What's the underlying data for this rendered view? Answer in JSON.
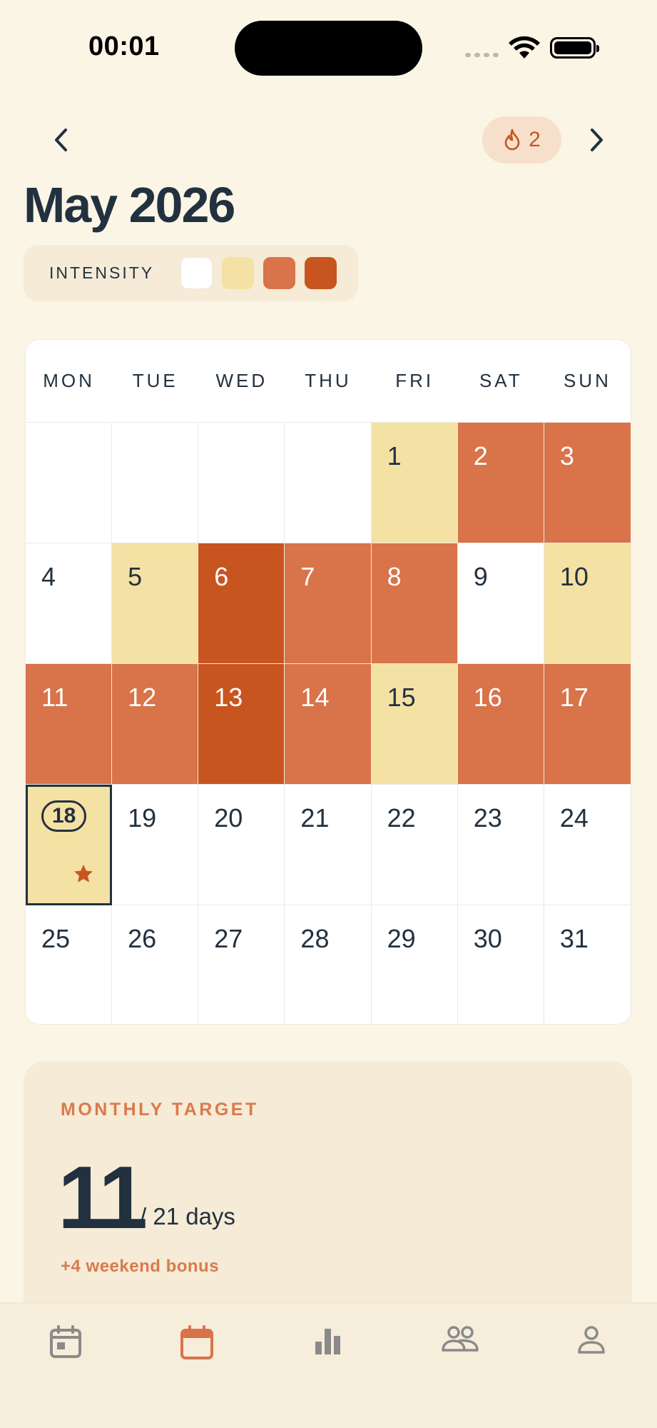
{
  "status_bar": {
    "time": "00:01"
  },
  "header": {
    "streak_count": "2",
    "title": "May 2026"
  },
  "legend": {
    "label": "INTENSITY",
    "colors": [
      "#FFFFFF",
      "#F4E1A4",
      "#D8734A",
      "#C8551F"
    ]
  },
  "calendar": {
    "weekdays": [
      "MON",
      "TUE",
      "WED",
      "THU",
      "FRI",
      "SAT",
      "SUN"
    ],
    "leading_empty": 4,
    "days": [
      {
        "day": "1",
        "level": 1
      },
      {
        "day": "2",
        "level": 2
      },
      {
        "day": "3",
        "level": 2
      },
      {
        "day": "4",
        "level": 0
      },
      {
        "day": "5",
        "level": 1
      },
      {
        "day": "6",
        "level": 3
      },
      {
        "day": "7",
        "level": 2
      },
      {
        "day": "8",
        "level": 2
      },
      {
        "day": "9",
        "level": 0
      },
      {
        "day": "10",
        "level": 1
      },
      {
        "day": "11",
        "level": 2
      },
      {
        "day": "12",
        "level": 2
      },
      {
        "day": "13",
        "level": 3
      },
      {
        "day": "14",
        "level": 2
      },
      {
        "day": "15",
        "level": 1
      },
      {
        "day": "16",
        "level": 2
      },
      {
        "day": "17",
        "level": 2
      },
      {
        "day": "18",
        "level": 1,
        "today": true,
        "starred": true
      },
      {
        "day": "19",
        "level": 0
      },
      {
        "day": "20",
        "level": 0
      },
      {
        "day": "21",
        "level": 0
      },
      {
        "day": "22",
        "level": 0
      },
      {
        "day": "23",
        "level": 0
      },
      {
        "day": "24",
        "level": 0
      },
      {
        "day": "25",
        "level": 0
      },
      {
        "day": "26",
        "level": 0
      },
      {
        "day": "27",
        "level": 0
      },
      {
        "day": "28",
        "level": 0
      },
      {
        "day": "29",
        "level": 0
      },
      {
        "day": "30",
        "level": 0
      },
      {
        "day": "31",
        "level": 0
      }
    ]
  },
  "monthly_target": {
    "label": "MONTHLY TARGET",
    "value": "11",
    "of_text": "/ 21 days",
    "bonus": "+4 weekend bonus"
  },
  "tabbar": {
    "tabs": [
      {
        "icon": "calendar-check-icon",
        "active": false
      },
      {
        "icon": "calendar-icon",
        "active": true
      },
      {
        "icon": "bar-chart-icon",
        "active": false
      },
      {
        "icon": "people-icon",
        "active": false
      },
      {
        "icon": "profile-icon",
        "active": false
      }
    ]
  }
}
